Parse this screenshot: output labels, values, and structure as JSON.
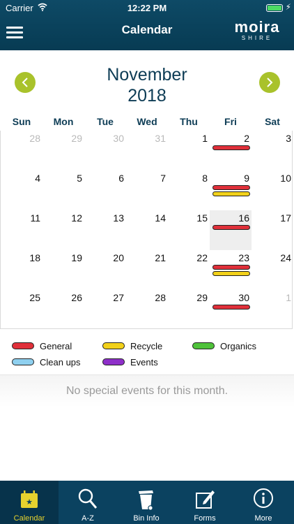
{
  "status": {
    "carrier": "Carrier",
    "time": "12:22 PM"
  },
  "nav": {
    "title": "Calendar",
    "logo_main": "moira",
    "logo_sub": "SHIRE"
  },
  "month": {
    "name": "November",
    "year": "2018"
  },
  "weekdays": [
    "Sun",
    "Mon",
    "Tue",
    "Wed",
    "Thu",
    "Fri",
    "Sat"
  ],
  "weeks": [
    [
      "28",
      "29",
      "30",
      "31",
      "1",
      "2",
      "3"
    ],
    [
      "4",
      "5",
      "6",
      "7",
      "8",
      "9",
      "10"
    ],
    [
      "11",
      "12",
      "13",
      "14",
      "15",
      "16",
      "17"
    ],
    [
      "18",
      "19",
      "20",
      "21",
      "22",
      "23",
      "24"
    ],
    [
      "25",
      "26",
      "27",
      "28",
      "29",
      "30",
      "1"
    ]
  ],
  "outside_month": [
    [
      0,
      0
    ],
    [
      0,
      1
    ],
    [
      0,
      2
    ],
    [
      0,
      3
    ],
    [
      4,
      6
    ]
  ],
  "today_cell": [
    2,
    5
  ],
  "collections": [
    {
      "cell": [
        0,
        5
      ],
      "types": [
        "general"
      ]
    },
    {
      "cell": [
        1,
        5
      ],
      "types": [
        "general",
        "recycle"
      ]
    },
    {
      "cell": [
        2,
        5
      ],
      "types": [
        "general"
      ]
    },
    {
      "cell": [
        3,
        5
      ],
      "types": [
        "general",
        "recycle"
      ]
    },
    {
      "cell": [
        4,
        5
      ],
      "types": [
        "general"
      ]
    }
  ],
  "legend": [
    {
      "key": "general",
      "label": "General",
      "color": "#e0303a"
    },
    {
      "key": "recycle",
      "label": "Recycle",
      "color": "#f2d11a"
    },
    {
      "key": "organics",
      "label": "Organics",
      "color": "#4fc23a"
    },
    {
      "key": "cleanups",
      "label": "Clean ups",
      "color": "#8fd0ef"
    },
    {
      "key": "events",
      "label": "Events",
      "color": "#8e2fc9"
    }
  ],
  "events_message": "No special events for this month.",
  "tabs": [
    {
      "label": "Calendar",
      "icon": "calendar-star-icon",
      "active": true
    },
    {
      "label": "A-Z",
      "icon": "magnifier-icon",
      "active": false
    },
    {
      "label": "Bin Info",
      "icon": "wheelie-bin-icon",
      "active": false
    },
    {
      "label": "Forms",
      "icon": "form-edit-icon",
      "active": false
    },
    {
      "label": "More",
      "icon": "info-icon",
      "active": false
    }
  ]
}
